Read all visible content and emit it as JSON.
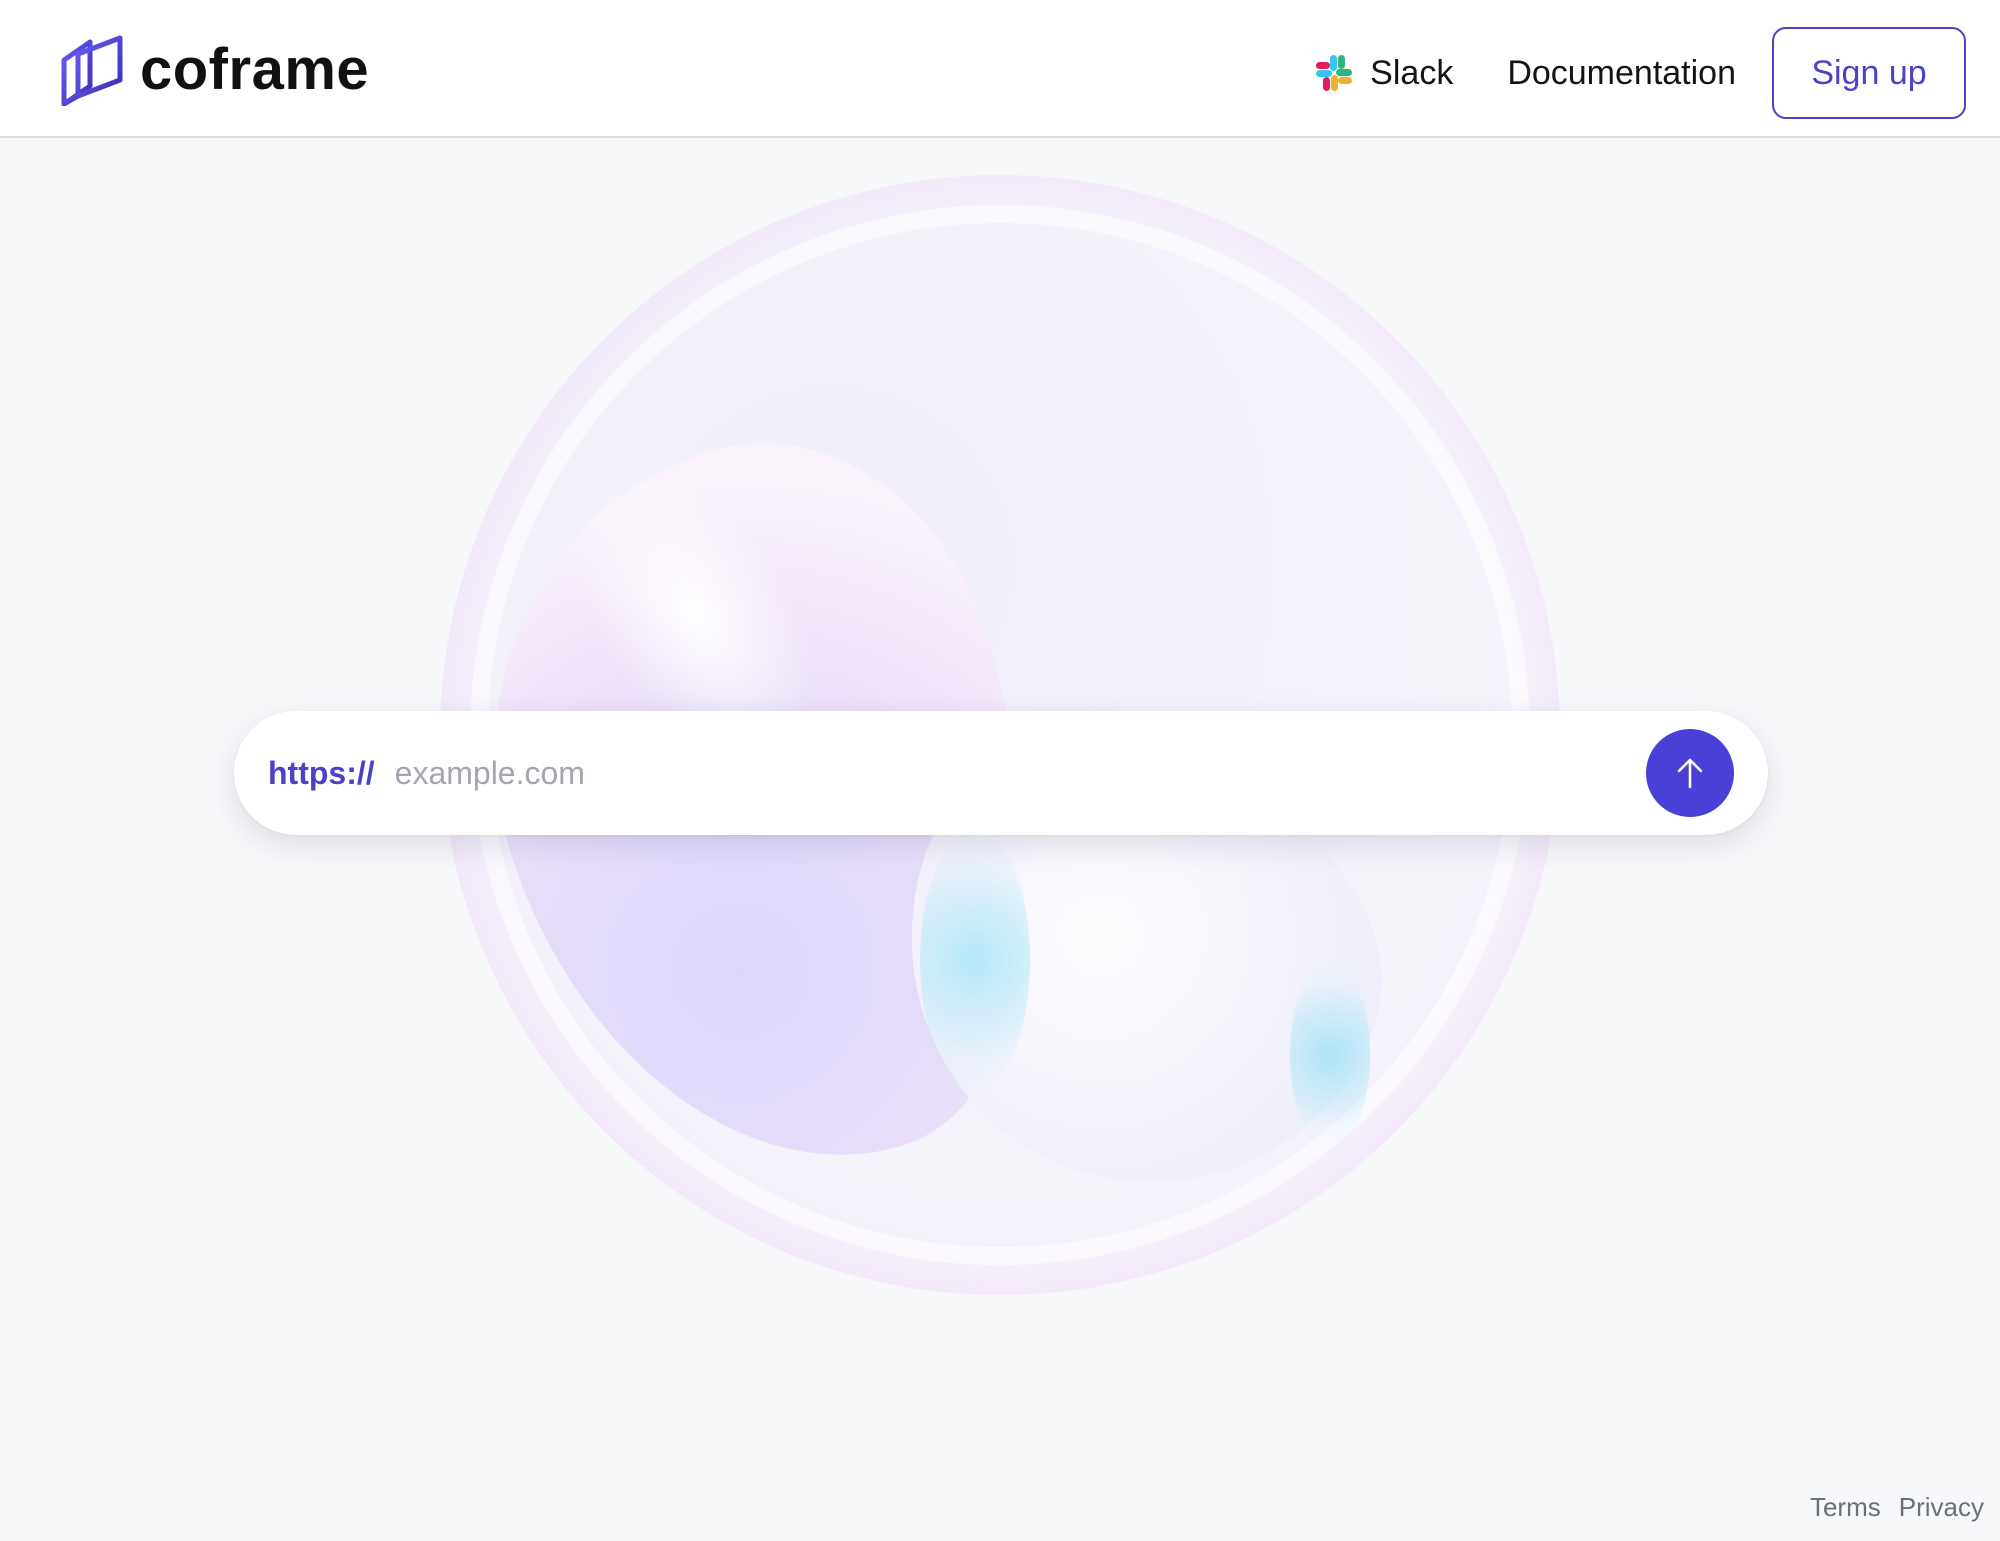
{
  "header": {
    "logo_text": "coframe",
    "nav": {
      "slack_label": "Slack",
      "documentation_label": "Documentation",
      "signup_label": "Sign up"
    }
  },
  "url_bar": {
    "prefix": "https://",
    "placeholder": "example.com",
    "value": ""
  },
  "footer": {
    "terms_label": "Terms",
    "privacy_label": "Privacy"
  },
  "colors": {
    "brand": "#4a43c8",
    "submit_button": "#4a3fd6",
    "background": "#f7f8fa"
  },
  "icons": {
    "logo": "coframe-logo-icon",
    "slack": "slack-icon",
    "submit": "arrow-up-icon"
  }
}
